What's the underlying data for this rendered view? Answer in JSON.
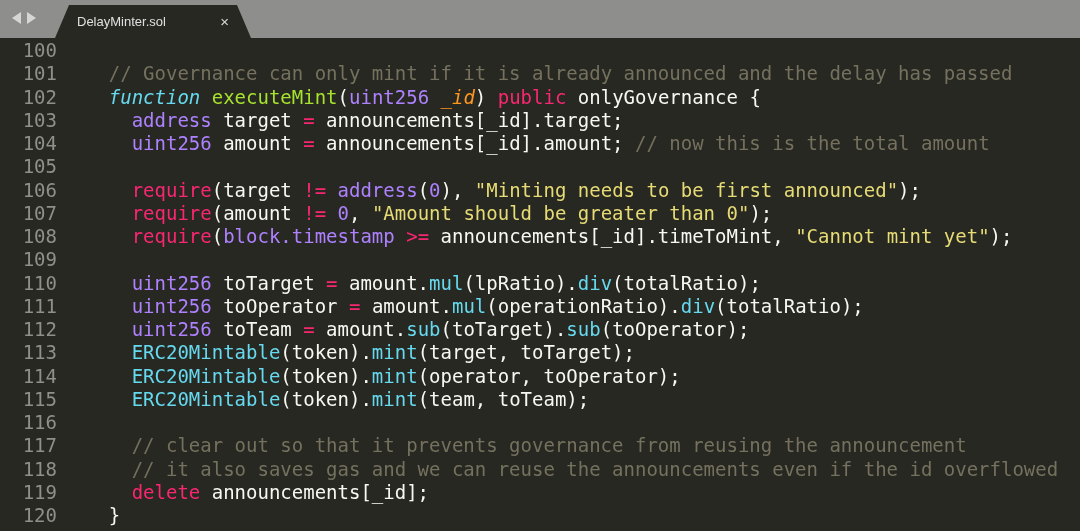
{
  "tab_bar": {
    "tabs": [
      {
        "title": "DelayMinter.sol",
        "close": "×",
        "selected": true
      }
    ]
  },
  "editor": {
    "lines": [
      {
        "number": "100"
      },
      {
        "number": "101",
        "tokens": [
          {
            "kind": "comment",
            "text": "// Governance can only mint if it is already announced and the delay has passed"
          }
        ]
      },
      {
        "number": "102",
        "tokens": [
          {
            "kind": "storage",
            "text": "function"
          },
          {
            "kind": "function",
            "text": " executeMint"
          },
          {
            "kind": "plain",
            "text": "("
          },
          {
            "kind": "type",
            "text": "uint256"
          },
          {
            "kind": "parameter",
            "text": " _id"
          },
          {
            "kind": "plain",
            "text": ") "
          },
          {
            "kind": "keyword",
            "text": "public"
          },
          {
            "kind": "plain",
            "text": " onlyGovernance {"
          }
        ],
        "children": [
          {
            "number": "103",
            "tokens": [
              {
                "kind": "type",
                "text": "address"
              },
              {
                "kind": "plain",
                "text": " target "
              },
              {
                "kind": "keyword",
                "text": "="
              },
              {
                "kind": "plain",
                "text": " announcements[_id].target;"
              }
            ]
          },
          {
            "number": "104",
            "tokens": [
              {
                "kind": "type",
                "text": "uint256"
              },
              {
                "kind": "plain",
                "text": " amount "
              },
              {
                "kind": "keyword",
                "text": "="
              },
              {
                "kind": "plain",
                "text": " announcements[_id].amount; "
              },
              {
                "kind": "comment",
                "text": "// now this is the total amount"
              }
            ]
          },
          {
            "number": "105"
          },
          {
            "number": "106",
            "tokens": [
              {
                "kind": "keyword",
                "text": "require"
              },
              {
                "kind": "plain",
                "text": "(target "
              },
              {
                "kind": "keyword",
                "text": "!="
              },
              {
                "kind": "type",
                "text": " address"
              },
              {
                "kind": "plain",
                "text": "("
              },
              {
                "kind": "number",
                "text": "0"
              },
              {
                "kind": "plain",
                "text": "), "
              },
              {
                "kind": "string",
                "text": "\"Minting needs to be first announced\""
              },
              {
                "kind": "plain",
                "text": ");"
              }
            ]
          },
          {
            "number": "107",
            "tokens": [
              {
                "kind": "keyword",
                "text": "require"
              },
              {
                "kind": "plain",
                "text": "(amount "
              },
              {
                "kind": "keyword",
                "text": "!="
              },
              {
                "kind": "number",
                "text": " 0"
              },
              {
                "kind": "plain",
                "text": ", "
              },
              {
                "kind": "string",
                "text": "\"Amount should be greater than 0\""
              },
              {
                "kind": "plain",
                "text": ");"
              }
            ]
          },
          {
            "number": "108",
            "tokens": [
              {
                "kind": "keyword",
                "text": "require"
              },
              {
                "kind": "plain",
                "text": "("
              },
              {
                "kind": "type",
                "text": "block.timestamp"
              },
              {
                "kind": "keyword",
                "text": " >="
              },
              {
                "kind": "plain",
                "text": " announcements[_id].timeToMint, "
              },
              {
                "kind": "string",
                "text": "\"Cannot mint yet\""
              },
              {
                "kind": "plain",
                "text": ");"
              }
            ]
          },
          {
            "number": "109"
          },
          {
            "number": "110",
            "tokens": [
              {
                "kind": "type",
                "text": "uint256"
              },
              {
                "kind": "plain",
                "text": " toTarget "
              },
              {
                "kind": "keyword",
                "text": "="
              },
              {
                "kind": "plain",
                "text": " amount."
              },
              {
                "kind": "builtin",
                "text": "mul"
              },
              {
                "kind": "plain",
                "text": "(lpRatio)."
              },
              {
                "kind": "builtin",
                "text": "div"
              },
              {
                "kind": "plain",
                "text": "(totalRatio);"
              }
            ]
          },
          {
            "number": "111",
            "tokens": [
              {
                "kind": "type",
                "text": "uint256"
              },
              {
                "kind": "plain",
                "text": " toOperator "
              },
              {
                "kind": "keyword",
                "text": "="
              },
              {
                "kind": "plain",
                "text": " amount."
              },
              {
                "kind": "builtin",
                "text": "mul"
              },
              {
                "kind": "plain",
                "text": "(operationRatio)."
              },
              {
                "kind": "builtin",
                "text": "div"
              },
              {
                "kind": "plain",
                "text": "(totalRatio);"
              }
            ]
          },
          {
            "number": "112",
            "tokens": [
              {
                "kind": "type",
                "text": "uint256"
              },
              {
                "kind": "plain",
                "text": " toTeam "
              },
              {
                "kind": "keyword",
                "text": "="
              },
              {
                "kind": "plain",
                "text": " amount."
              },
              {
                "kind": "builtin",
                "text": "sub"
              },
              {
                "kind": "plain",
                "text": "(toTarget)."
              },
              {
                "kind": "builtin",
                "text": "sub"
              },
              {
                "kind": "plain",
                "text": "(toOperator);"
              }
            ]
          },
          {
            "number": "113",
            "tokens": [
              {
                "kind": "builtin",
                "text": "ERC20Mintable"
              },
              {
                "kind": "plain",
                "text": "(token)."
              },
              {
                "kind": "builtin",
                "text": "mint"
              },
              {
                "kind": "plain",
                "text": "(target, toTarget);"
              }
            ]
          },
          {
            "number": "114",
            "tokens": [
              {
                "kind": "builtin",
                "text": "ERC20Mintable"
              },
              {
                "kind": "plain",
                "text": "(token)."
              },
              {
                "kind": "builtin",
                "text": "mint"
              },
              {
                "kind": "plain",
                "text": "(operator, toOperator);"
              }
            ]
          },
          {
            "number": "115",
            "tokens": [
              {
                "kind": "builtin",
                "text": "ERC20Mintable"
              },
              {
                "kind": "plain",
                "text": "(token)."
              },
              {
                "kind": "builtin",
                "text": "mint"
              },
              {
                "kind": "plain",
                "text": "(team, toTeam);"
              }
            ]
          },
          {
            "number": "116"
          },
          {
            "number": "117",
            "tokens": [
              {
                "kind": "comment",
                "text": "// clear out so that it prevents governance from reusing the announcement"
              }
            ]
          },
          {
            "number": "118",
            "tokens": [
              {
                "kind": "comment",
                "text": "// it also saves gas and we can reuse the announcements even if the id overflowed"
              }
            ]
          },
          {
            "number": "119",
            "tokens": [
              {
                "kind": "keyword",
                "text": "delete"
              },
              {
                "kind": "plain",
                "text": " announcements[_id];"
              }
            ]
          }
        ]
      },
      {
        "number": "120",
        "tokens": [
          {
            "kind": "plain",
            "text": "}"
          }
        ]
      }
    ]
  }
}
